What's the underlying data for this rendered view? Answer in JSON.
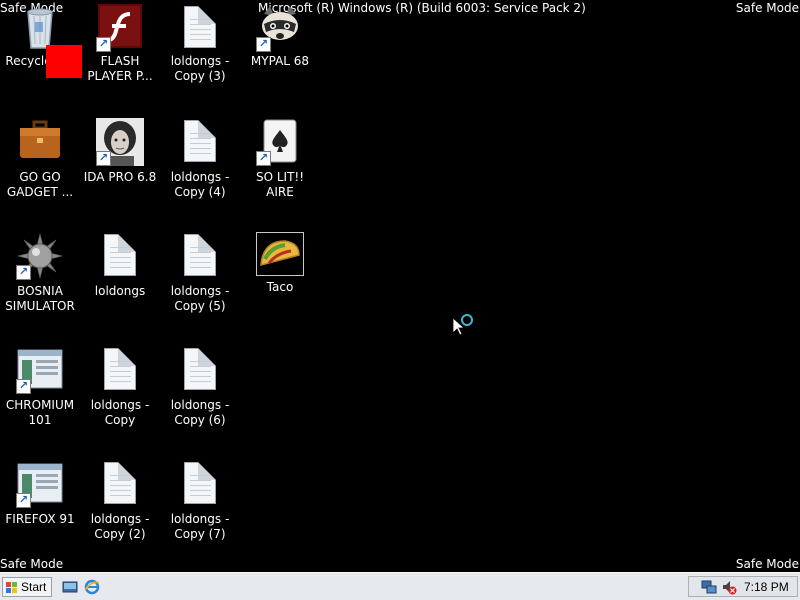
{
  "watermark": {
    "safe_mode": "Safe Mode",
    "build": "Microsoft (R) Windows (R) (Build 6003: Service Pack 2)"
  },
  "desktop": {
    "icons": [
      {
        "label": "Recycle Bin",
        "icon": "recycle-bin-icon"
      },
      {
        "label": "FLASH PLAYER P...",
        "icon": "flash-player-icon"
      },
      {
        "label": "loldongs - Copy (3)",
        "icon": "text-document-icon"
      },
      {
        "label": "MYPAL 68",
        "icon": "raccoon-icon"
      },
      {
        "label": "GO GO GADGET ...",
        "icon": "briefcase-icon"
      },
      {
        "label": "IDA PRO 6.8",
        "icon": "ida-portrait-icon"
      },
      {
        "label": "loldongs - Copy (4)",
        "icon": "text-document-icon"
      },
      {
        "label": "SO LIT!! AIRE",
        "icon": "solitaire-card-icon"
      },
      {
        "label": "BOSNIA SIMULATOR",
        "icon": "spiked-ball-icon"
      },
      {
        "label": "loldongs",
        "icon": "text-document-icon"
      },
      {
        "label": "loldongs - Copy (5)",
        "icon": "text-document-icon"
      },
      {
        "label": "Taco",
        "icon": "taco-icon"
      },
      {
        "label": "CHROMIUM 101",
        "icon": "app-window-icon"
      },
      {
        "label": "loldongs - Copy",
        "icon": "text-document-icon"
      },
      {
        "label": "loldongs - Copy (6)",
        "icon": "text-document-icon"
      },
      {
        "label": "FIREFOX 91",
        "icon": "app-window-icon"
      },
      {
        "label": "loldongs - Copy (2)",
        "icon": "text-document-icon"
      },
      {
        "label": "loldongs - Copy (7)",
        "icon": "text-document-icon"
      }
    ]
  },
  "taskbar": {
    "start_label": "Start",
    "quick_launch": [
      "show-desktop-icon",
      "internet-explorer-icon"
    ],
    "tray_icons": [
      "network-icon",
      "volume-muted-icon"
    ],
    "clock": "7:18 PM"
  },
  "colors": {
    "desktop_bg": "#000000",
    "red_square": "#ff0000",
    "taskbar_bg": "#e6e9ee"
  }
}
